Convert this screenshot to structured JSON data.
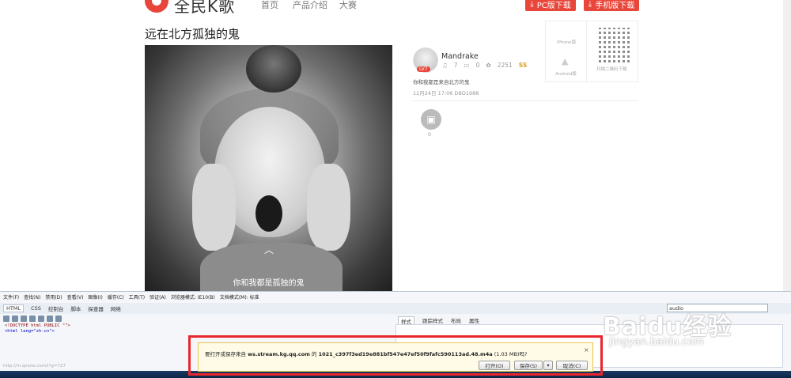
{
  "header": {
    "logo_text": "全民K歌",
    "nav": [
      "首页",
      "产品介绍",
      "大赛"
    ],
    "pc_download": "PC版下载",
    "mobile_download": "手机版下载"
  },
  "song": {
    "title": "远在北方孤独的鬼",
    "caption": "你和我都是孤独的鬼"
  },
  "user": {
    "name": "Mandrake",
    "level_badge": "LV7",
    "listens": "7",
    "comments": "0",
    "flowers": "2251",
    "rank_badge": "SS",
    "description": "你和我都是来自北方的鬼",
    "meta": "12月24日 17:06 DBD1688",
    "gift_count": "0"
  },
  "download_panel": {
    "iphone_label": "iPhone版",
    "android_label": "Android版",
    "qr_label": "扫描二维码下载"
  },
  "devtools": {
    "menu": [
      "文件(F)",
      "查找(N)",
      "禁用(D)",
      "查看(V)",
      "图像(I)",
      "缓存(C)",
      "工具(T)",
      "验证(A)",
      "浏览器模式: IE10(B)",
      "文档模式(M): 标准"
    ],
    "tabs": [
      "HTML",
      "CSS",
      "控制台",
      "脚本",
      "探查器",
      "网络"
    ],
    "search_value": "audio",
    "code_line1": "<!DOCTYPE html PUBLIC \"\">",
    "code_line2": "<html lang=\"zh-cn\">",
    "right_tabs": [
      "样式",
      "跟踪样式",
      "布局",
      "属性"
    ],
    "status_url": "http://m.qzone.com/l?g=727"
  },
  "notification": {
    "prefix": "要打开或保存来自",
    "host": "ws.stream.kg.qq.com",
    "middle": "的",
    "filename": "1021_c397f3ed19e881bf547e47ef50f9fafc590113ad.48.m4a",
    "size": "(1.03 MB)吗?",
    "open": "打开(O)",
    "save": "保存(S)",
    "cancel": "取消(C)"
  },
  "watermark": {
    "brand": "Baidu经验",
    "url": "jingyan.baidu.com"
  },
  "colors": {
    "brand_red": "#e8463a",
    "highlight": "#e8262c"
  }
}
